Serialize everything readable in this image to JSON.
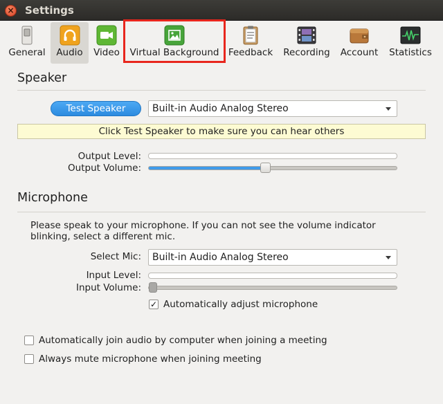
{
  "window": {
    "title": "Settings"
  },
  "tabs": [
    {
      "id": "general",
      "label": "General",
      "icon": "toggle-switch-icon"
    },
    {
      "id": "audio",
      "label": "Audio",
      "icon": "headphones-icon",
      "active": true
    },
    {
      "id": "video",
      "label": "Video",
      "icon": "video-camera-icon"
    },
    {
      "id": "virtual_background",
      "label": "Virtual Background",
      "icon": "picture-icon"
    },
    {
      "id": "feedback",
      "label": "Feedback",
      "icon": "clipboard-icon"
    },
    {
      "id": "recording",
      "label": "Recording",
      "icon": "film-strip-icon"
    },
    {
      "id": "account",
      "label": "Account",
      "icon": "wallet-icon"
    },
    {
      "id": "statistics",
      "label": "Statistics",
      "icon": "waveform-monitor-icon"
    }
  ],
  "speaker": {
    "heading": "Speaker",
    "test_button": "Test Speaker",
    "device": "Built-in Audio Analog Stereo",
    "hint": "Click Test Speaker to make sure you can hear others",
    "output_level_label": "Output Level:",
    "output_volume_label": "Output Volume:",
    "output_level": 0,
    "output_volume": 0.47
  },
  "microphone": {
    "heading": "Microphone",
    "instructions": "Please speak to your microphone. If you can not see the volume indicator blinking, select a different mic.",
    "select_label": "Select Mic:",
    "device": "Built-in Audio Analog Stereo",
    "input_level_label": "Input Level:",
    "input_volume_label": "Input Volume:",
    "input_level": 0,
    "input_volume": 0.0,
    "auto_adjust_label": "Automatically adjust microphone",
    "auto_adjust_checked": true
  },
  "options": {
    "auto_join_label": "Automatically join audio by computer when joining a meeting",
    "auto_join_checked": false,
    "always_mute_label": "Always mute microphone when joining meeting",
    "always_mute_checked": false
  },
  "colors": {
    "accent": "#2c8be0",
    "highlight_box": "#e8261d",
    "hint_bg": "#fdfbd3"
  }
}
